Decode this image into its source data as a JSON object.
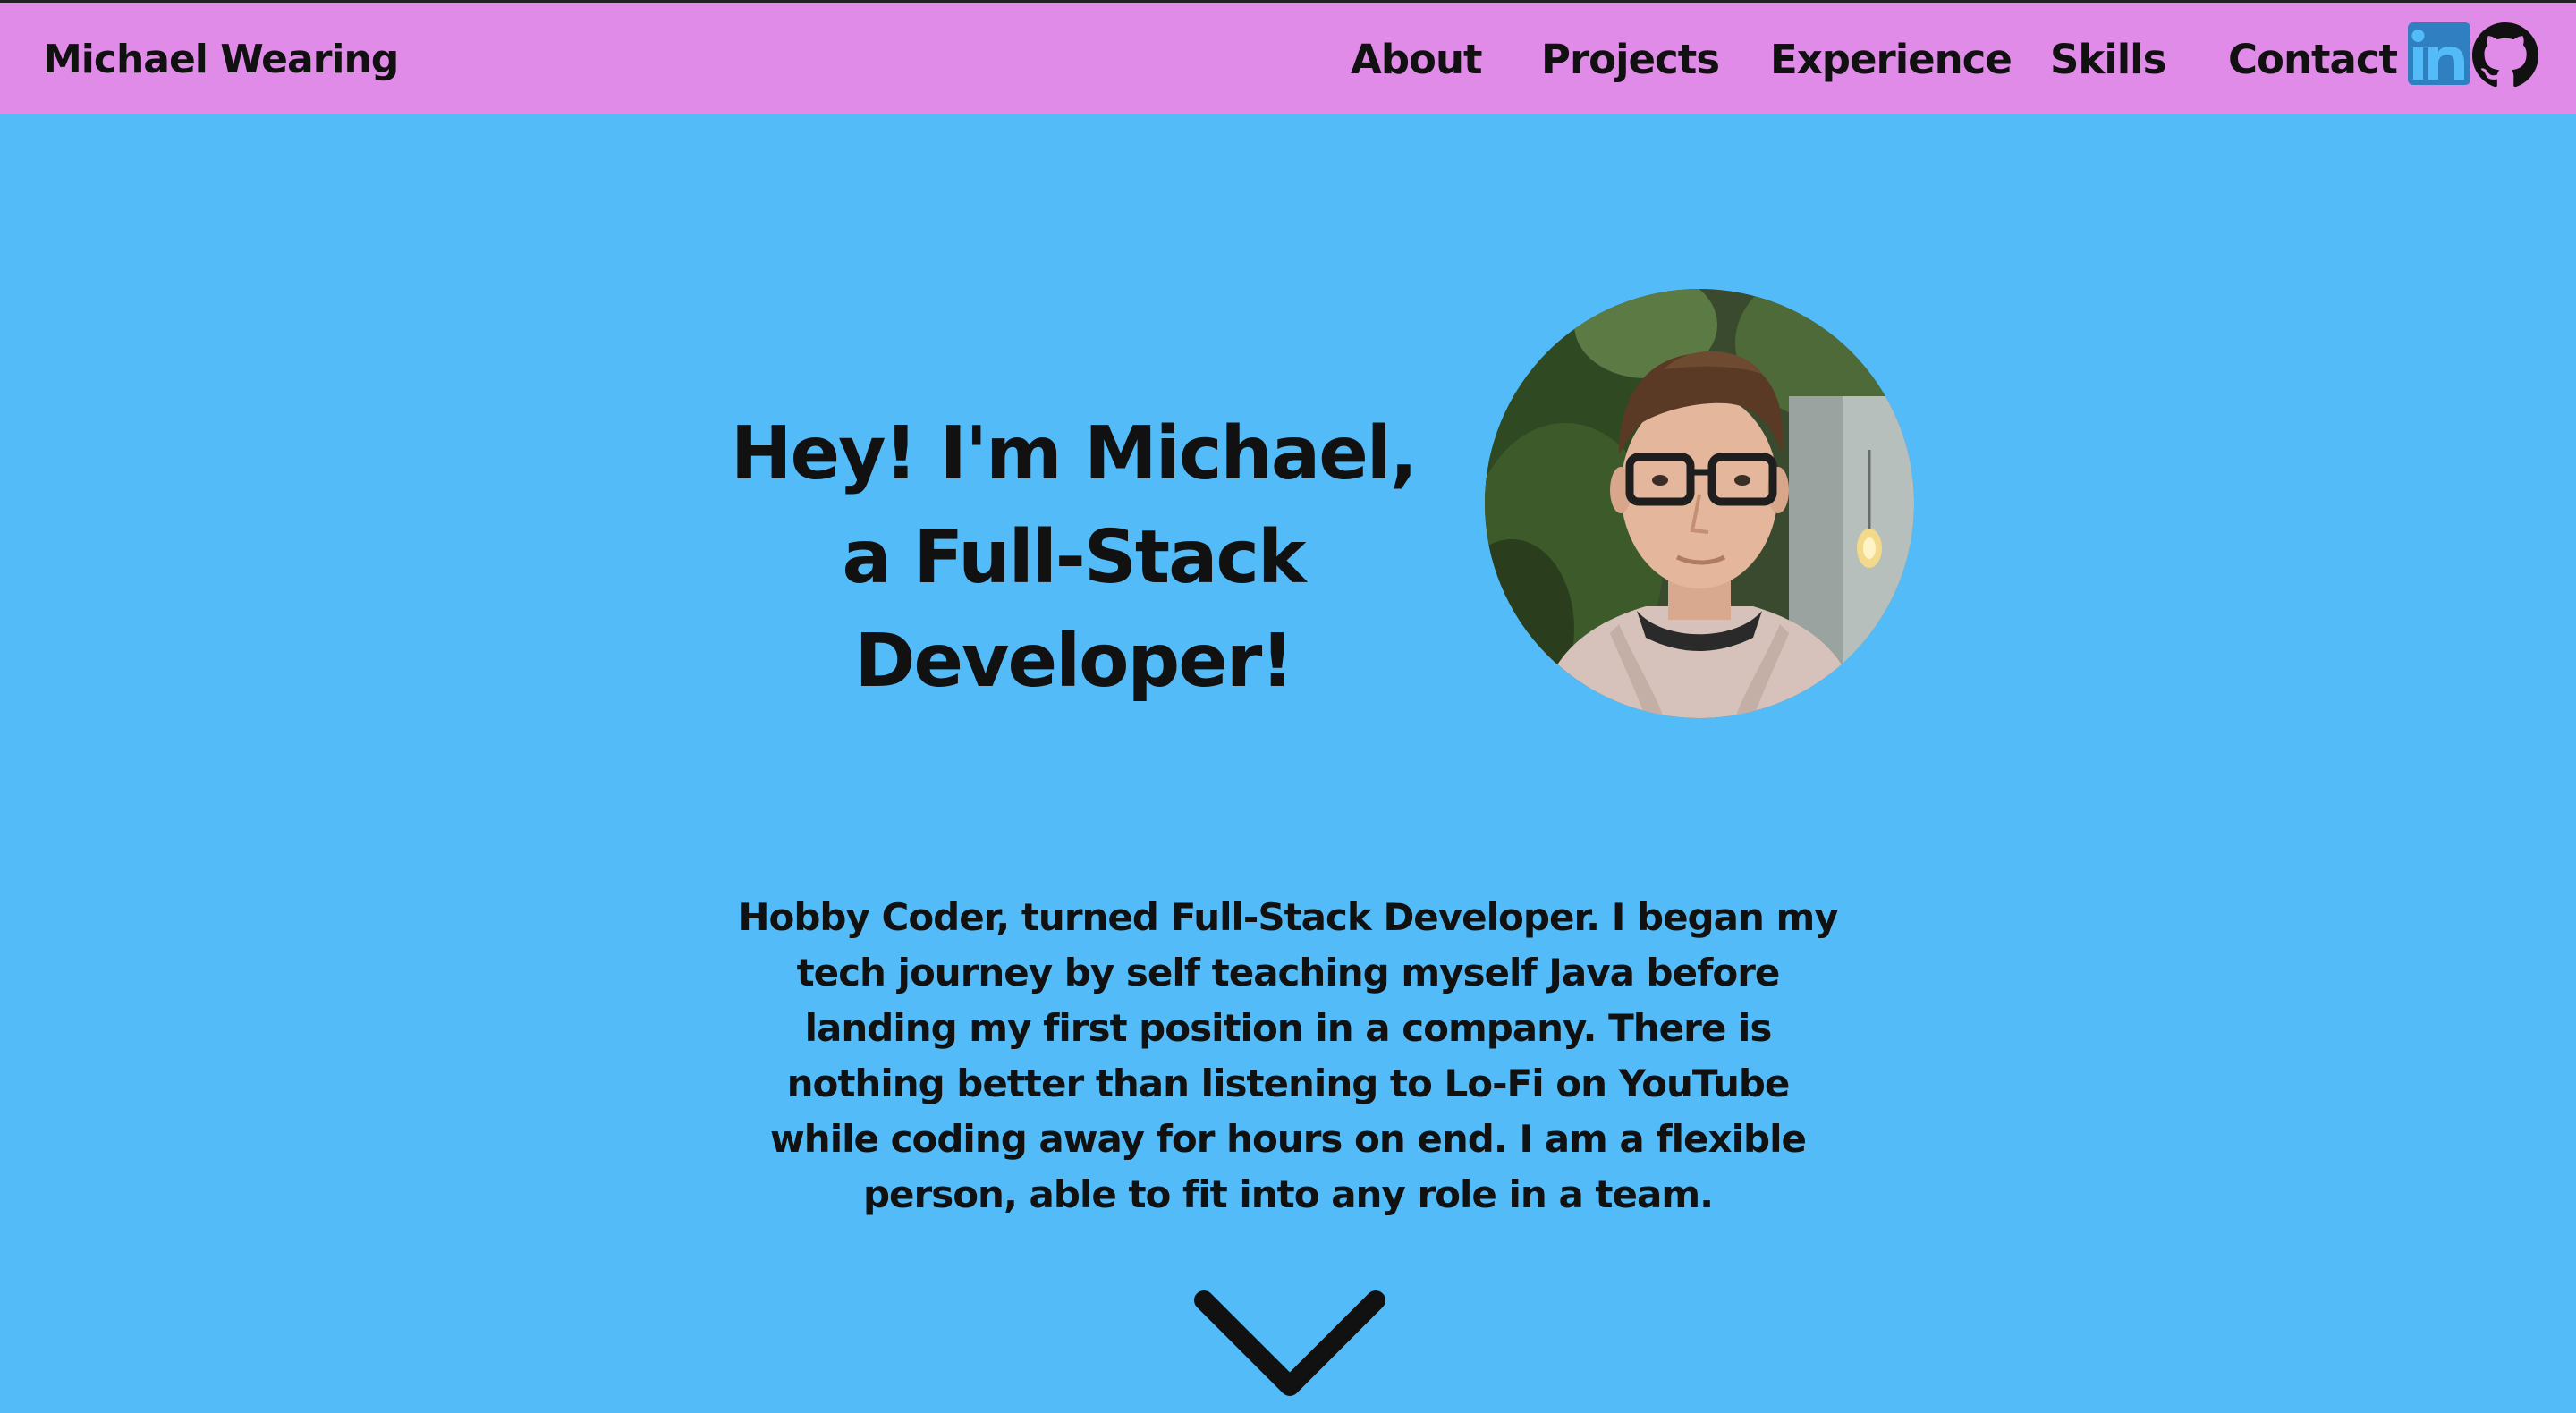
{
  "navbar": {
    "brand": "Michael Wearing",
    "links": [
      "About",
      "Projects",
      "Experience",
      "Skills",
      "Contact"
    ],
    "social": {
      "linkedin": "linkedin-icon",
      "github": "github-icon"
    },
    "background_color": "#e18be8"
  },
  "hero": {
    "title_line1": "Hey! I'm Michael,",
    "title_line2": "a Full-Stack Developer!",
    "portrait": "profile-photo"
  },
  "bio": {
    "text": "Hobby Coder, turned Full-Stack Developer. I began my tech journey by self teaching myself Java before landing my first position in a company. There is nothing better than listening to Lo-Fi on YouTube while coding away for hours on end. I am a flexible person, able to fit into any role in a team."
  },
  "scroll": {
    "icon": "chevron-down-icon"
  },
  "colors": {
    "page_background": "#53bcf8",
    "text": "#111111",
    "linkedin_blue": "#2f7fc1"
  }
}
